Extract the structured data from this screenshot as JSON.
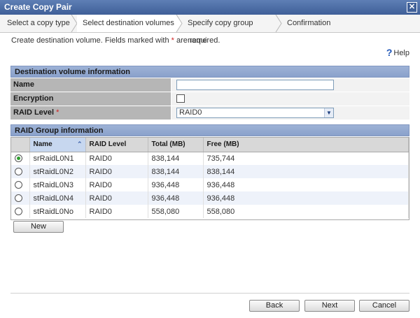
{
  "window": {
    "title": "Create Copy Pair",
    "close_glyph": "✕"
  },
  "steps": [
    {
      "label": "Select a copy type",
      "active": false
    },
    {
      "label": "Select destination volumes",
      "active": true
    },
    {
      "label": "Specify copy group name",
      "active": false
    },
    {
      "label": "Confirmation",
      "active": false
    }
  ],
  "description": {
    "text_before": "Create destination volume. Fields marked with ",
    "asterisk": "*",
    "text_after": " are required."
  },
  "help": {
    "icon": "help-icon",
    "glyph": "?",
    "label": "Help"
  },
  "dest_section": {
    "title": "Destination volume information",
    "name_label": "Name",
    "name_value": "",
    "encryption_label": "Encryption",
    "encryption_checked": false,
    "raid_label": "RAID Level",
    "raid_required_mark": "*",
    "raid_value": "RAID0",
    "dropdown_glyph": "▼"
  },
  "raid_section": {
    "title": "RAID Group information"
  },
  "table": {
    "columns": [
      "",
      "Name",
      "RAID Level",
      "Total (MB)",
      "Free (MB)"
    ],
    "sort_glyph": "⌃",
    "rows": [
      {
        "selected": true,
        "name": "srRaidL0N1",
        "raid": "RAID0",
        "total": "838,144",
        "free": "735,744"
      },
      {
        "selected": false,
        "name": "stRaidL0N2",
        "raid": "RAID0",
        "total": "838,144",
        "free": "838,144"
      },
      {
        "selected": false,
        "name": "stRaidL0N3",
        "raid": "RAID0",
        "total": "936,448",
        "free": "936,448"
      },
      {
        "selected": false,
        "name": "stRaidL0N4",
        "raid": "RAID0",
        "total": "936,448",
        "free": "936,448"
      },
      {
        "selected": false,
        "name": "stRaidL0No",
        "raid": "RAID0",
        "total": "558,080",
        "free": "558,080"
      }
    ]
  },
  "buttons": {
    "new": "New",
    "back": "Back",
    "next": "Next",
    "cancel": "Cancel"
  },
  "colors": {
    "title_bar": "#3f5f98",
    "section_header": "#8aa1cb",
    "required": "#d02020",
    "selected_radio": "#2d9d2d"
  }
}
